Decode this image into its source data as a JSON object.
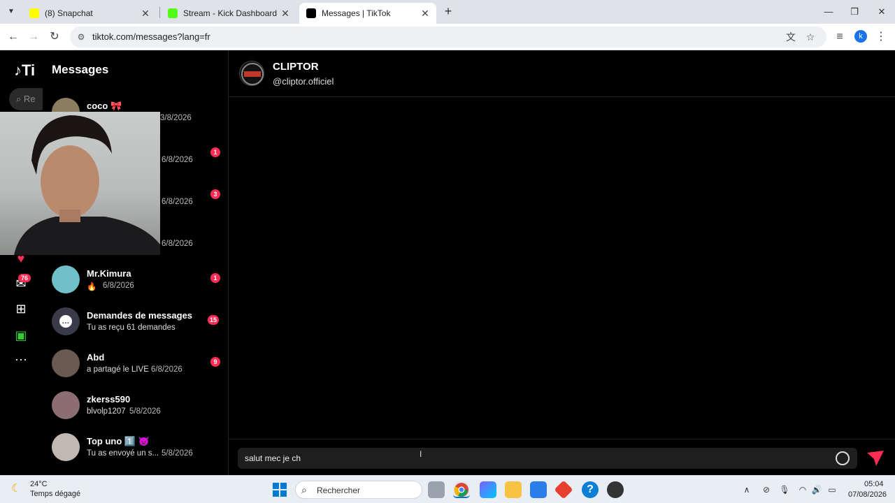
{
  "browser": {
    "tabs": [
      {
        "label": "(8) Snapchat",
        "favicon_color": "#fffc00"
      },
      {
        "label": "Stream - Kick Dashboard",
        "favicon_color": "#53fc18"
      },
      {
        "label": "Messages | TikTok",
        "favicon_color": "#000000"
      }
    ],
    "url": "tiktok.com/messages?lang=fr",
    "profile_initial": "k"
  },
  "tiktok": {
    "logo": "Ti",
    "search_placeholder": "Re",
    "inbox_badge": "76",
    "messages_title": "Messages",
    "conversations": [
      {
        "name": "coco 🎀",
        "sub": "",
        "date": "3/8/2026",
        "badge": ""
      },
      {
        "name": "",
        "sub": "",
        "date": "6/8/2026",
        "badge": "1"
      },
      {
        "name": "",
        "sub": "",
        "date": "6/8/2026",
        "badge": "3"
      },
      {
        "name": "",
        "sub": "",
        "date": "6/8/2026",
        "badge": ""
      },
      {
        "name": "Mr.Kimura",
        "sub": "🔥",
        "date": "6/8/2026",
        "badge": "1"
      },
      {
        "name": "Demandes de messages",
        "sub": "Tu as reçu 61 demandes",
        "date": "",
        "badge": "15"
      },
      {
        "name": "Abd",
        "sub": "a partagé le LIVE",
        "date": "6/8/2026",
        "badge": "9"
      },
      {
        "name": "zkerss590",
        "sub": "blvolp1207",
        "date": "5/8/2026",
        "badge": ""
      },
      {
        "name": "Top uno 1️⃣ 👿",
        "sub": "Tu as envoyé un s...",
        "date": "5/8/2026",
        "badge": ""
      }
    ],
    "chat": {
      "name": "CLIPTOR",
      "handle": "@cliptor.officiel",
      "input_value": "salut mec je ch"
    }
  },
  "taskbar": {
    "temperature": "24°C",
    "weather": "Temps dégagé",
    "search_label": "Rechercher",
    "time": "05:04",
    "date": "07/08/2026"
  }
}
